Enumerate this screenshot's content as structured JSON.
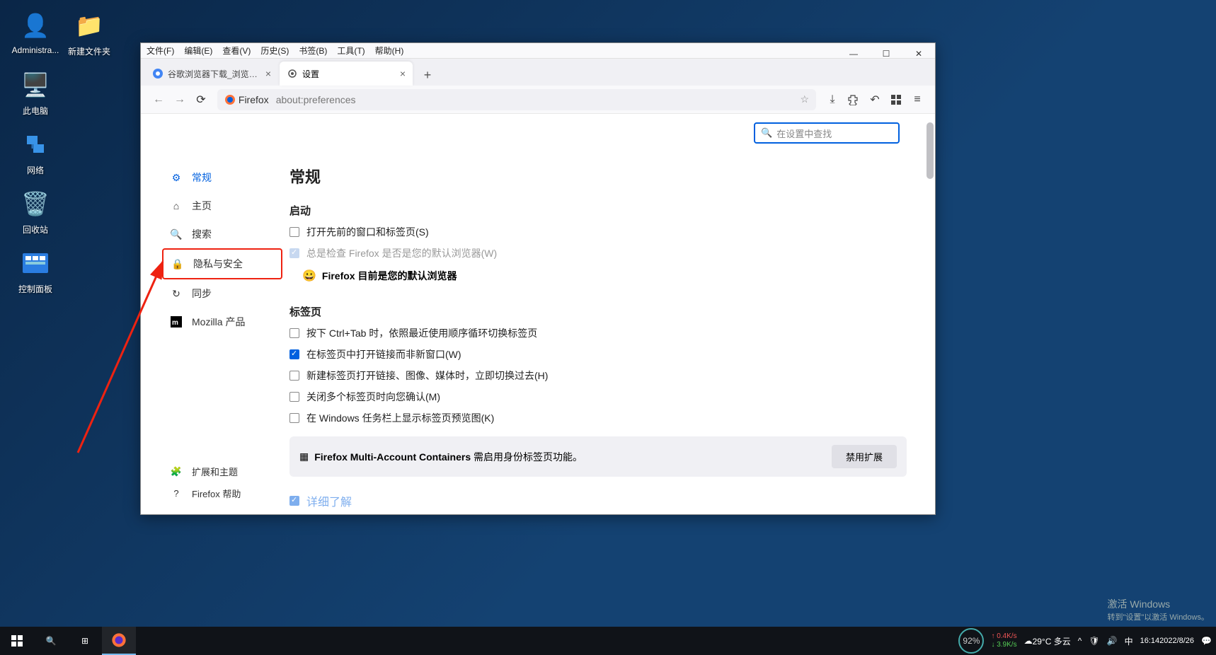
{
  "desktop": {
    "icons": [
      {
        "label": "Administra...",
        "icon": "👤"
      },
      {
        "label": "新建文件夹",
        "icon": "📁"
      },
      {
        "label": "此电脑",
        "icon": "🖥️"
      },
      {
        "label": "网络",
        "icon": "🖧"
      },
      {
        "label": "回收站",
        "icon": "🗑️"
      },
      {
        "label": "控制面板",
        "icon": "⚙️"
      }
    ]
  },
  "firefox": {
    "menu": [
      "文件(F)",
      "编辑(E)",
      "查看(V)",
      "历史(S)",
      "书签(B)",
      "工具(T)",
      "帮助(H)"
    ],
    "tabs": [
      {
        "title": "谷歌浏览器下载_浏览器官网入口",
        "active": false
      },
      {
        "title": "设置",
        "active": true
      }
    ],
    "url_prefix": "Firefox",
    "url": "about:preferences",
    "search_placeholder": "在设置中查找",
    "sidebar": [
      {
        "icon": "gear",
        "label": "常规",
        "active": true
      },
      {
        "icon": "home",
        "label": "主页"
      },
      {
        "icon": "search",
        "label": "搜索"
      },
      {
        "icon": "lock",
        "label": "隐私与安全",
        "highlight": true
      },
      {
        "icon": "sync",
        "label": "同步"
      },
      {
        "icon": "moz",
        "label": "Mozilla 产品"
      }
    ],
    "sidebar_bottom": [
      {
        "icon": "puzzle",
        "label": "扩展和主题"
      },
      {
        "icon": "help",
        "label": "Firefox 帮助"
      }
    ],
    "prefs": {
      "h1": "常规",
      "startup": {
        "heading": "启动",
        "opt1": "打开先前的窗口和标签页(S)",
        "opt2": "总是检查 Firefox 是否是您的默认浏览器(W)",
        "default_msg": "Firefox 目前是您的默认浏览器"
      },
      "tabs": {
        "heading": "标签页",
        "opt1": "按下 Ctrl+Tab 时，依照最近使用顺序循环切换标签页",
        "opt2": "在标签页中打开链接而非新窗口(W)",
        "opt3": "新建标签页打开链接、图像、媒体时，立即切换过去(H)",
        "opt4": "关闭多个标签页时向您确认(M)",
        "opt5": "在 Windows 任务栏上显示标签页预览图(K)"
      },
      "ext": {
        "text_bold": "Firefox Multi-Account Containers",
        "text_rest": " 需启用身份标签页功能。",
        "btn": "禁用扩展"
      },
      "detail_link": "详细了解"
    }
  },
  "watermark": {
    "l1": "激活 Windows",
    "l2": "转到\"设置\"以激活 Windows。"
  },
  "taskbar": {
    "weather": "29°C 多云",
    "gauge": "92%",
    "net_up": "0.4K/s",
    "net_down": "3.9K/s",
    "ime": "中",
    "time": "16:14",
    "date": "2022/8/26"
  }
}
